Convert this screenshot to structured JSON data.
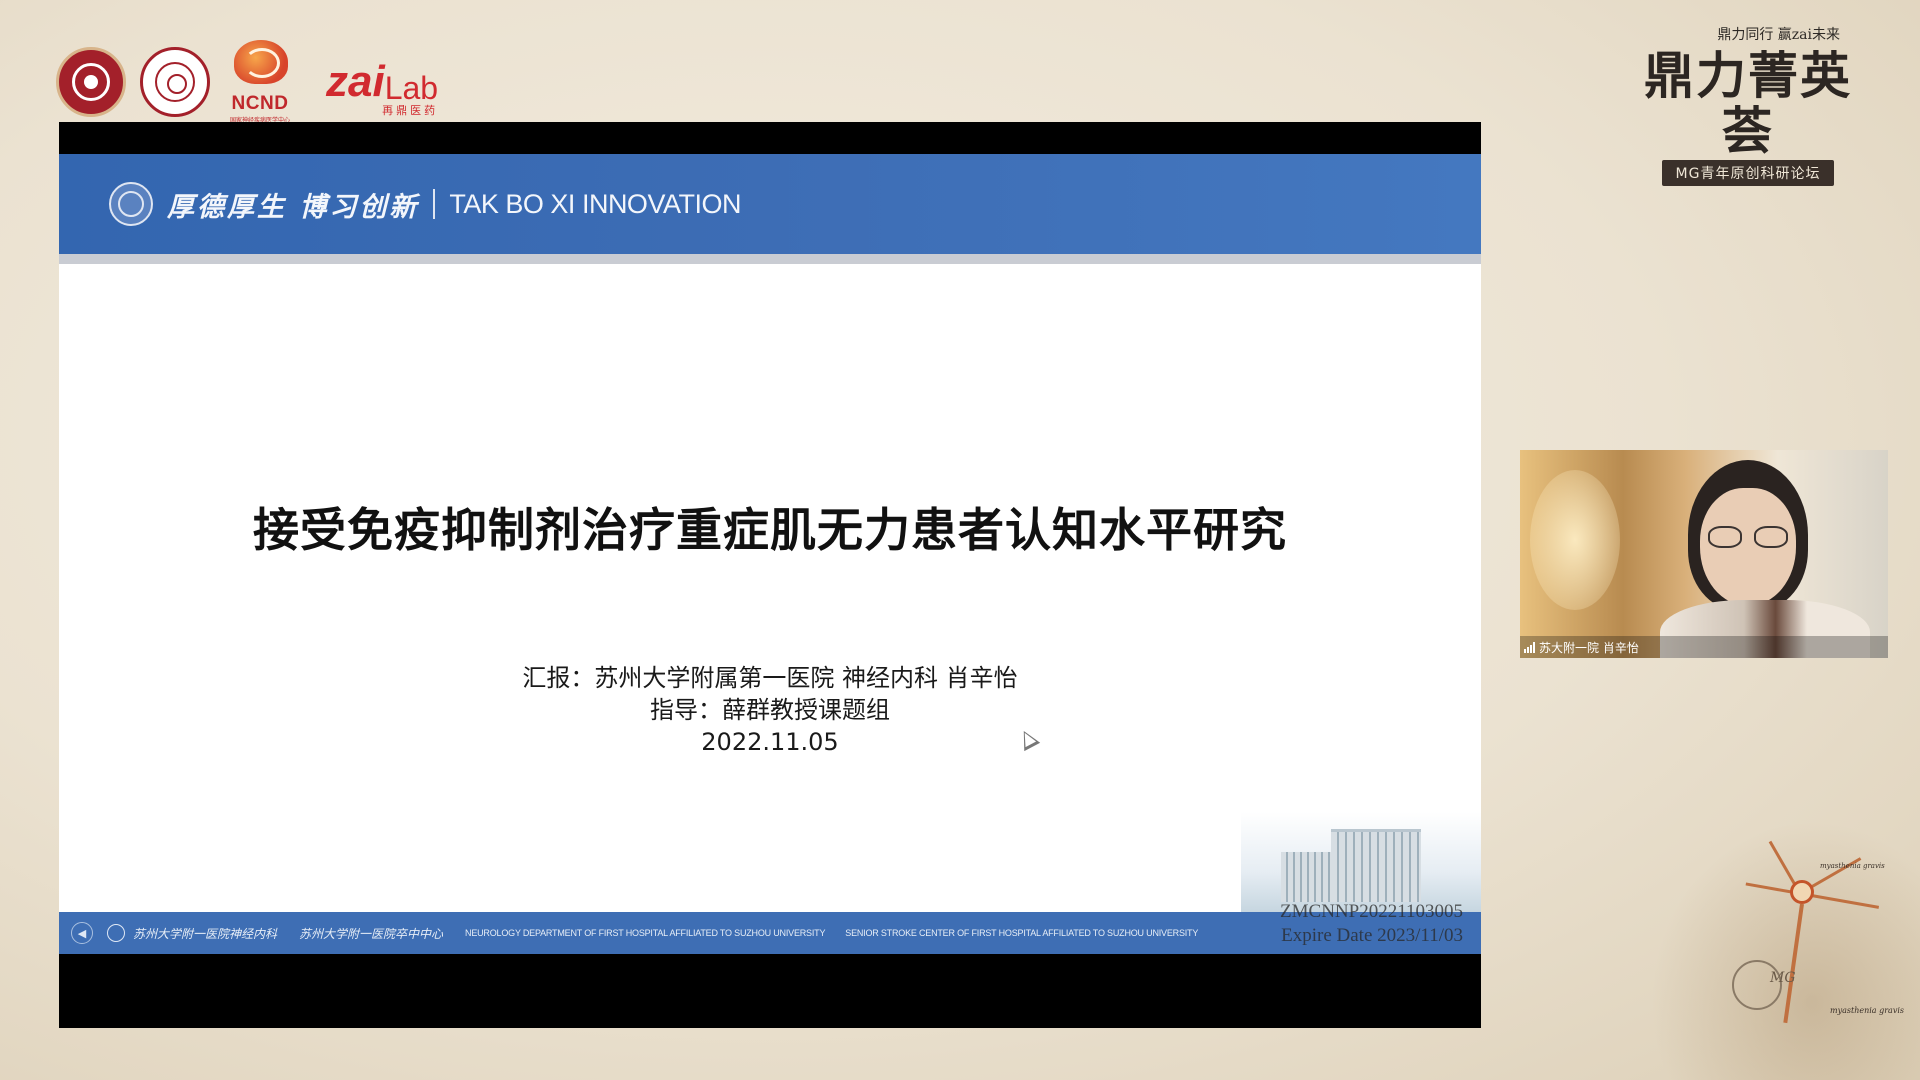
{
  "logos": {
    "ncnd_label": "NCND",
    "ncnd_subtitle": "国家神经疾病医学中心",
    "zai_main": "zai",
    "zai_lab": "Lab",
    "zai_cn": "再鼎医药"
  },
  "event_brand": {
    "slogan": "鼎力同行 赢zai未来",
    "title": "鼎力菁英荟",
    "subtitle": "MG青年原创科研论坛"
  },
  "slide": {
    "header": {
      "motto_cn": "厚德厚生 博习创新",
      "motto_en": "TAK BO XI  INNOVATION"
    },
    "title": "接受免疫抑制剂治疗重症肌无力患者认知水平研究",
    "presenter_line": "汇报：苏州大学附属第一医院  神经内科  肖辛怡",
    "advisor_line": "指导：薛群教授课题组",
    "date": "2022.11.05",
    "footer": {
      "dept_cn_1": "苏州大学附一医院神经内科",
      "dept_cn_2": "苏州大学附一医院卒中中心",
      "dept_en_1": "NEUROLOGY DEPARTMENT OF FIRST HOSPITAL AFFILIATED TO SUZHOU UNIVERSITY",
      "dept_en_2": "SENIOR STROKE CENTER OF FIRST HOSPITAL AFFILIATED TO SUZHOU UNIVERSITY"
    },
    "watermark": {
      "code": "ZMCNNP20221103005",
      "expire": "Expire Date 2023/11/03"
    }
  },
  "webcam": {
    "participant_name": "苏大附一院 肖辛怡"
  },
  "art": {
    "label_mg": "MG",
    "label_1": "myasthenia gravis",
    "label_2": "myasthenia gravis"
  },
  "icons": {
    "nav_prev": "◀",
    "nav_next": "▶"
  },
  "colors": {
    "slide_header_blue": "#3d6db5",
    "slide_footer_blue": "#3e6eb4",
    "brand_red": "#d12a2f",
    "background_parchment": "#ebe2d1"
  }
}
